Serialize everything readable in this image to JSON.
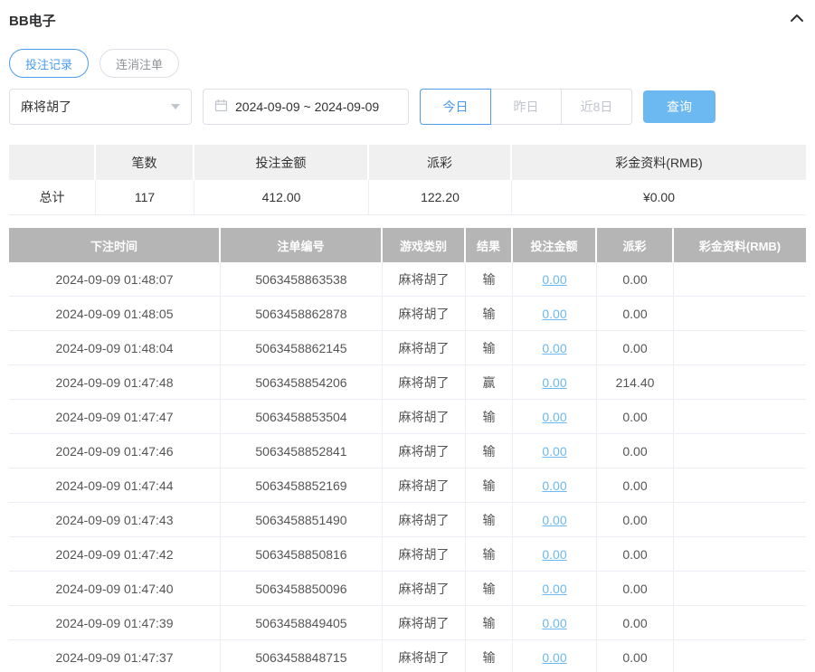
{
  "header": {
    "title": "BB电子"
  },
  "tabs": [
    {
      "label": "投注记录",
      "active": true
    },
    {
      "label": "连消注单",
      "active": false
    }
  ],
  "filters": {
    "game_select": {
      "value": "麻将胡了",
      "icon": "caret-down-icon"
    },
    "date_range": {
      "value": "2024-09-09 ~ 2024-09-09",
      "icon": "calendar-icon"
    },
    "quick_ranges": [
      {
        "label": "今日",
        "active": true
      },
      {
        "label": "昨日",
        "active": false
      },
      {
        "label": "近8日",
        "active": false
      }
    ],
    "query_button": "查询"
  },
  "summary": {
    "headers": [
      "",
      "笔数",
      "投注金额",
      "派彩",
      "彩金资料(RMB)"
    ],
    "total": {
      "label": "总计",
      "count": "117",
      "bet_amount": "412.00",
      "payout": "122.20",
      "jackpot": "¥0.00"
    }
  },
  "table": {
    "headers": [
      "下注时间",
      "注单编号",
      "游戏类别",
      "结果",
      "投注金额",
      "派彩",
      "彩金资料(RMB)"
    ],
    "rows": [
      {
        "time": "2024-09-09 01:48:07",
        "order_no": "5063458863538",
        "game": "麻将胡了",
        "result": "输",
        "bet_amount": "0.00",
        "payout": "0.00",
        "jackpot": ""
      },
      {
        "time": "2024-09-09 01:48:05",
        "order_no": "5063458862878",
        "game": "麻将胡了",
        "result": "输",
        "bet_amount": "0.00",
        "payout": "0.00",
        "jackpot": ""
      },
      {
        "time": "2024-09-09 01:48:04",
        "order_no": "5063458862145",
        "game": "麻将胡了",
        "result": "输",
        "bet_amount": "0.00",
        "payout": "0.00",
        "jackpot": ""
      },
      {
        "time": "2024-09-09 01:47:48",
        "order_no": "5063458854206",
        "game": "麻将胡了",
        "result": "赢",
        "bet_amount": "0.00",
        "payout": "214.40",
        "jackpot": ""
      },
      {
        "time": "2024-09-09 01:47:47",
        "order_no": "5063458853504",
        "game": "麻将胡了",
        "result": "输",
        "bet_amount": "0.00",
        "payout": "0.00",
        "jackpot": ""
      },
      {
        "time": "2024-09-09 01:47:46",
        "order_no": "5063458852841",
        "game": "麻将胡了",
        "result": "输",
        "bet_amount": "0.00",
        "payout": "0.00",
        "jackpot": ""
      },
      {
        "time": "2024-09-09 01:47:44",
        "order_no": "5063458852169",
        "game": "麻将胡了",
        "result": "输",
        "bet_amount": "0.00",
        "payout": "0.00",
        "jackpot": ""
      },
      {
        "time": "2024-09-09 01:47:43",
        "order_no": "5063458851490",
        "game": "麻将胡了",
        "result": "输",
        "bet_amount": "0.00",
        "payout": "0.00",
        "jackpot": ""
      },
      {
        "time": "2024-09-09 01:47:42",
        "order_no": "5063458850816",
        "game": "麻将胡了",
        "result": "输",
        "bet_amount": "0.00",
        "payout": "0.00",
        "jackpot": ""
      },
      {
        "time": "2024-09-09 01:47:40",
        "order_no": "5063458850096",
        "game": "麻将胡了",
        "result": "输",
        "bet_amount": "0.00",
        "payout": "0.00",
        "jackpot": ""
      },
      {
        "time": "2024-09-09 01:47:39",
        "order_no": "5063458849405",
        "game": "麻将胡了",
        "result": "输",
        "bet_amount": "0.00",
        "payout": "0.00",
        "jackpot": ""
      },
      {
        "time": "2024-09-09 01:47:37",
        "order_no": "5063458848715",
        "game": "麻将胡了",
        "result": "输",
        "bet_amount": "0.00",
        "payout": "0.00",
        "jackpot": ""
      }
    ]
  },
  "colors": {
    "accent_blue": "#4a9cec",
    "button_blue": "#6cb8f0",
    "link_blue": "#6cb8f0",
    "table_header_bg": "#b5b5b5",
    "summary_header_bg": "#f0f0f0",
    "text_dark": "#303133",
    "text_muted": "#909399",
    "border_light": "#ebeef5"
  }
}
